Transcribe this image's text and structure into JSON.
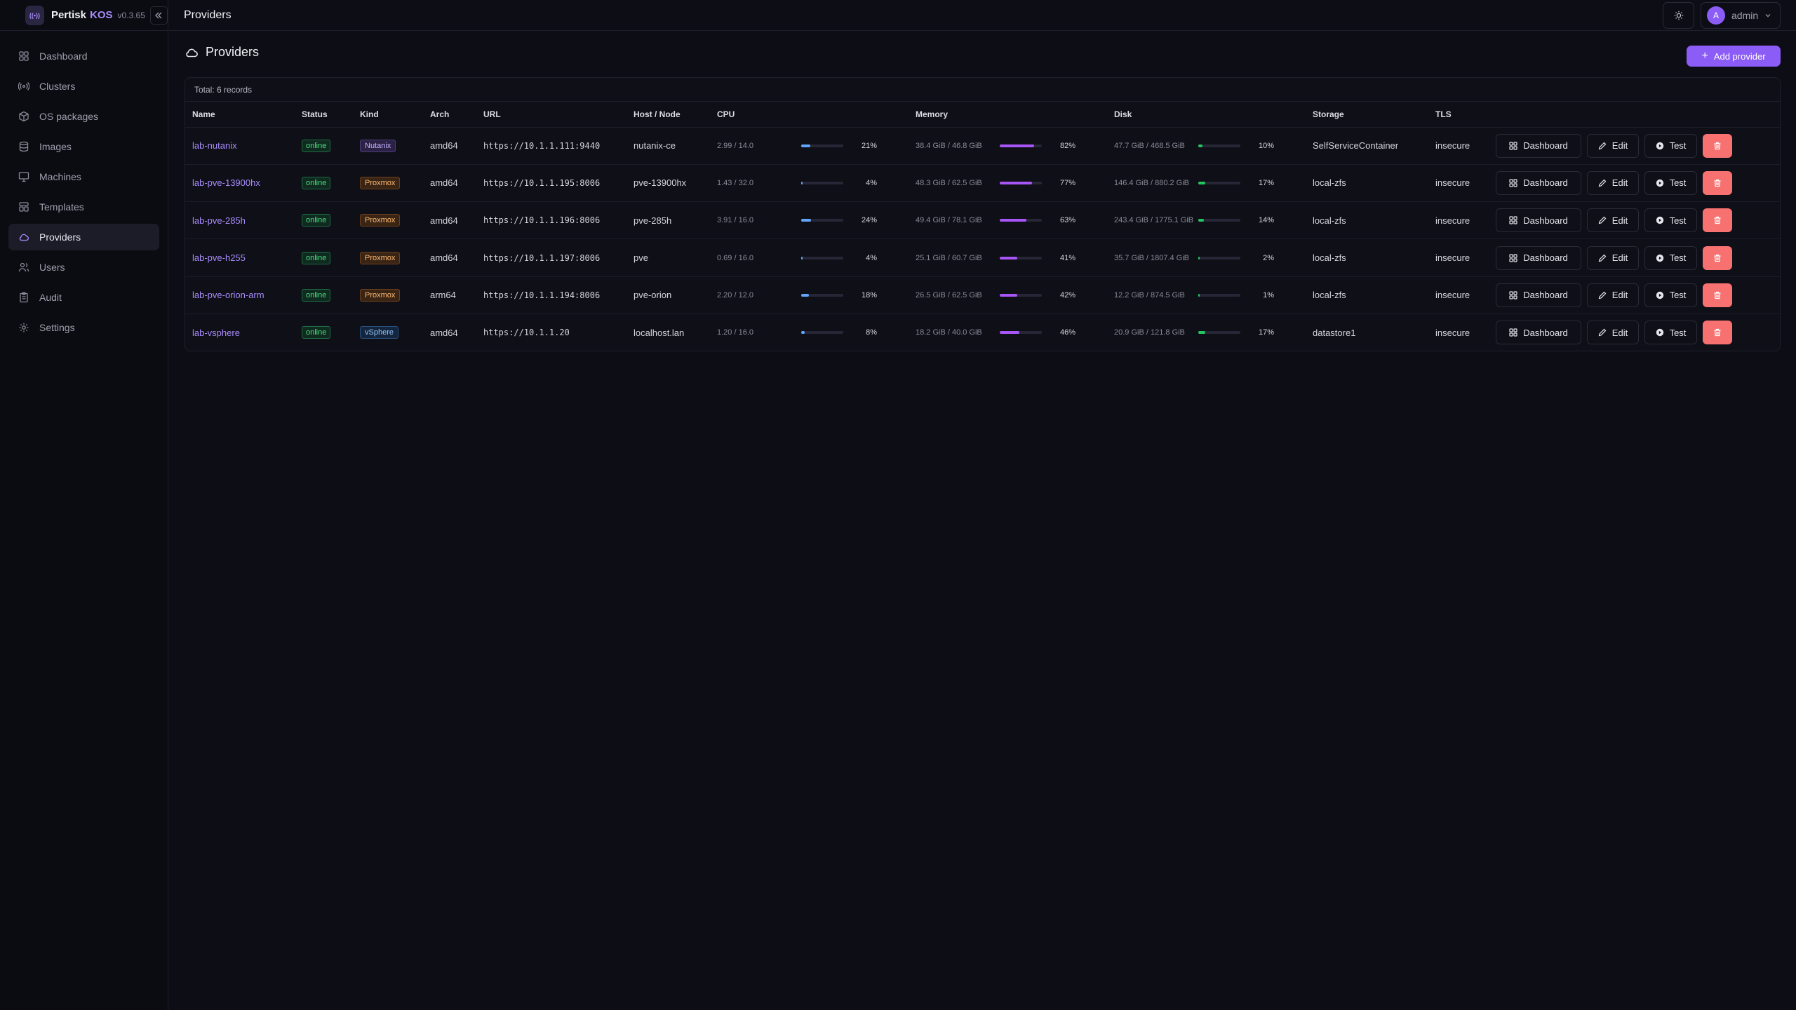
{
  "app": {
    "name": "Pertisk",
    "name_accent": "KOS",
    "version": "v0.3.65",
    "logo_glyph": "((•))"
  },
  "sidebar": {
    "items": [
      {
        "label": "Dashboard",
        "icon": "grid-icon",
        "active": false
      },
      {
        "label": "Clusters",
        "icon": "radio-icon",
        "active": false
      },
      {
        "label": "OS packages",
        "icon": "package-icon",
        "active": false
      },
      {
        "label": "Images",
        "icon": "database-icon",
        "active": false
      },
      {
        "label": "Machines",
        "icon": "monitor-icon",
        "active": false
      },
      {
        "label": "Templates",
        "icon": "template-icon",
        "active": false
      },
      {
        "label": "Providers",
        "icon": "cloud-icon",
        "active": true
      },
      {
        "label": "Users",
        "icon": "users-icon",
        "active": false
      },
      {
        "label": "Audit",
        "icon": "clipboard-icon",
        "active": false
      },
      {
        "label": "Settings",
        "icon": "gear-icon",
        "active": false
      }
    ]
  },
  "header": {
    "title": "Providers",
    "user_initial": "A",
    "user_name": "admin"
  },
  "page": {
    "title": "Providers",
    "add_button": "Add provider",
    "total": "Total: 6 records"
  },
  "table": {
    "columns": [
      "Name",
      "Status",
      "Kind",
      "Arch",
      "URL",
      "Host / Node",
      "CPU",
      "Memory",
      "Disk",
      "Storage",
      "TLS"
    ],
    "action_labels": {
      "dashboard": "Dashboard",
      "edit": "Edit",
      "test": "Test"
    },
    "rows": [
      {
        "name": "lab-nutanix",
        "status": "online",
        "kind": "Nutanix",
        "arch": "amd64",
        "url": "https://10.1.1.111:9440",
        "host": "nutanix-ce",
        "cpu_text": "2.99 / 14.0",
        "cpu_pct": 21,
        "cpu_pct_label": "21%",
        "mem_text": "38.4 GiB / 46.8 GiB",
        "mem_pct": 82,
        "mem_pct_label": "82%",
        "disk_text": "47.7 GiB / 468.5 GiB",
        "disk_pct": 10,
        "disk_pct_label": "10%",
        "storage": "SelfServiceContainer",
        "tls": "insecure"
      },
      {
        "name": "lab-pve-13900hx",
        "status": "online",
        "kind": "Proxmox",
        "arch": "amd64",
        "url": "https://10.1.1.195:8006",
        "host": "pve-13900hx",
        "cpu_text": "1.43 / 32.0",
        "cpu_pct": 4,
        "cpu_pct_label": "4%",
        "mem_text": "48.3 GiB / 62.5 GiB",
        "mem_pct": 77,
        "mem_pct_label": "77%",
        "disk_text": "146.4 GiB / 880.2 GiB",
        "disk_pct": 17,
        "disk_pct_label": "17%",
        "storage": "local-zfs",
        "tls": "insecure"
      },
      {
        "name": "lab-pve-285h",
        "status": "online",
        "kind": "Proxmox",
        "arch": "amd64",
        "url": "https://10.1.1.196:8006",
        "host": "pve-285h",
        "cpu_text": "3.91 / 16.0",
        "cpu_pct": 24,
        "cpu_pct_label": "24%",
        "mem_text": "49.4 GiB / 78.1 GiB",
        "mem_pct": 63,
        "mem_pct_label": "63%",
        "disk_text": "243.4 GiB / 1775.1 GiB",
        "disk_pct": 14,
        "disk_pct_label": "14%",
        "storage": "local-zfs",
        "tls": "insecure"
      },
      {
        "name": "lab-pve-h255",
        "status": "online",
        "kind": "Proxmox",
        "arch": "amd64",
        "url": "https://10.1.1.197:8006",
        "host": "pve",
        "cpu_text": "0.69 / 16.0",
        "cpu_pct": 4,
        "cpu_pct_label": "4%",
        "mem_text": "25.1 GiB / 60.7 GiB",
        "mem_pct": 41,
        "mem_pct_label": "41%",
        "disk_text": "35.7 GiB / 1807.4 GiB",
        "disk_pct": 2,
        "disk_pct_label": "2%",
        "storage": "local-zfs",
        "tls": "insecure"
      },
      {
        "name": "lab-pve-orion-arm",
        "status": "online",
        "kind": "Proxmox",
        "arch": "arm64",
        "url": "https://10.1.1.194:8006",
        "host": "pve-orion",
        "cpu_text": "2.20 / 12.0",
        "cpu_pct": 18,
        "cpu_pct_label": "18%",
        "mem_text": "26.5 GiB / 62.5 GiB",
        "mem_pct": 42,
        "mem_pct_label": "42%",
        "disk_text": "12.2 GiB / 874.5 GiB",
        "disk_pct": 1,
        "disk_pct_label": "1%",
        "storage": "local-zfs",
        "tls": "insecure"
      },
      {
        "name": "lab-vsphere",
        "status": "online",
        "kind": "vSphere",
        "arch": "amd64",
        "url": "https://10.1.1.20",
        "host": "localhost.lan",
        "cpu_text": "1.20 / 16.0",
        "cpu_pct": 8,
        "cpu_pct_label": "8%",
        "mem_text": "18.2 GiB / 40.0 GiB",
        "mem_pct": 46,
        "mem_pct_label": "46%",
        "disk_text": "20.9 GiB / 121.8 GiB",
        "disk_pct": 17,
        "disk_pct_label": "17%",
        "storage": "datastore1",
        "tls": "insecure"
      }
    ]
  },
  "colors": {
    "accent": "#8b5cf6",
    "link": "#a78bfa",
    "cpu_bar": "#60a5fa",
    "mem_bar": "#a855f7",
    "disk_bar": "#22c55e",
    "danger": "#f87171",
    "kind_nutanix": "#c4b5fd",
    "kind_proxmox": "#fb923c",
    "kind_vsphere": "#60a5fa"
  }
}
